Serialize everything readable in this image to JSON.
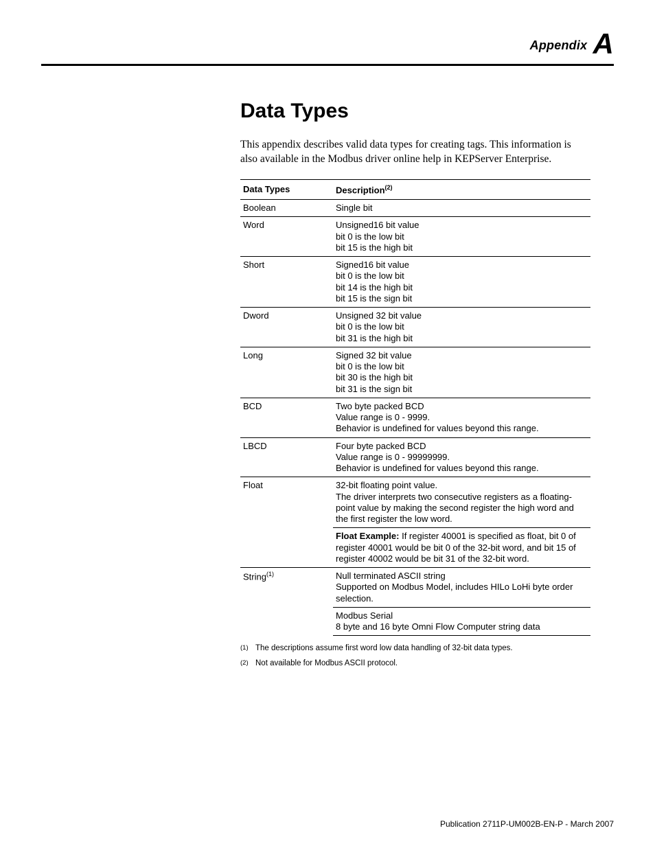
{
  "header": {
    "appendix_word": "Appendix",
    "appendix_letter": "A"
  },
  "title": "Data Types",
  "intro": "This appendix describes valid data types for creating tags. This information is also available in the Modbus driver online help in KEPServer Enterprise.",
  "table": {
    "head_type": "Data Types",
    "head_desc": "Description",
    "head_desc_sup": "(2)",
    "rows": [
      {
        "type": "Boolean",
        "desc": "Single bit"
      },
      {
        "type": "Word",
        "desc": "Unsigned16 bit value\nbit 0 is the low bit\nbit 15 is the high bit"
      },
      {
        "type": "Short",
        "desc": "Signed16 bit value\nbit 0 is the low bit\nbit 14 is the high bit\nbit 15 is the sign bit"
      },
      {
        "type": "Dword",
        "desc": "Unsigned 32 bit value\nbit 0 is the low bit\nbit 31 is the high bit"
      },
      {
        "type": "Long",
        "desc": "Signed 32 bit value\nbit 0 is the low bit\nbit 30 is the high bit\nbit 31 is the sign bit"
      },
      {
        "type": "BCD",
        "desc": "Two byte packed BCD\nValue range is 0 - 9999.\nBehavior is undefined for values beyond this range."
      },
      {
        "type": "LBCD",
        "desc": "Four byte packed BCD\nValue range is 0 - 99999999.\nBehavior is undefined for values beyond this range."
      }
    ],
    "float_row": {
      "type": "Float",
      "desc1": "32-bit floating point value.\nThe driver interprets two consecutive registers as a floating-point value by making the second register the high word and the first register the low word.",
      "example_label": "Float Example:",
      "example_rest": " If register 40001 is specified as float, bit 0 of register 40001 would be bit 0 of the 32-bit word, and bit 15 of register 40002 would be bit 31 of the 32-bit word."
    },
    "string_row": {
      "type": "String",
      "type_sup": "(1)",
      "desc1": "Null terminated ASCII string\nSupported on Modbus Model, includes HILo LoHi byte order selection.",
      "desc2": "Modbus Serial\n8 byte and 16 byte Omni Flow Computer string data"
    }
  },
  "footnotes": {
    "fn1_mark": "(1)",
    "fn1_text": "The descriptions assume first word low data handling of 32-bit data types.",
    "fn2_mark": "(2)",
    "fn2_text": "Not available for Modbus ASCII protocol."
  },
  "publication": "Publication 2711P-UM002B-EN-P - March 2007"
}
